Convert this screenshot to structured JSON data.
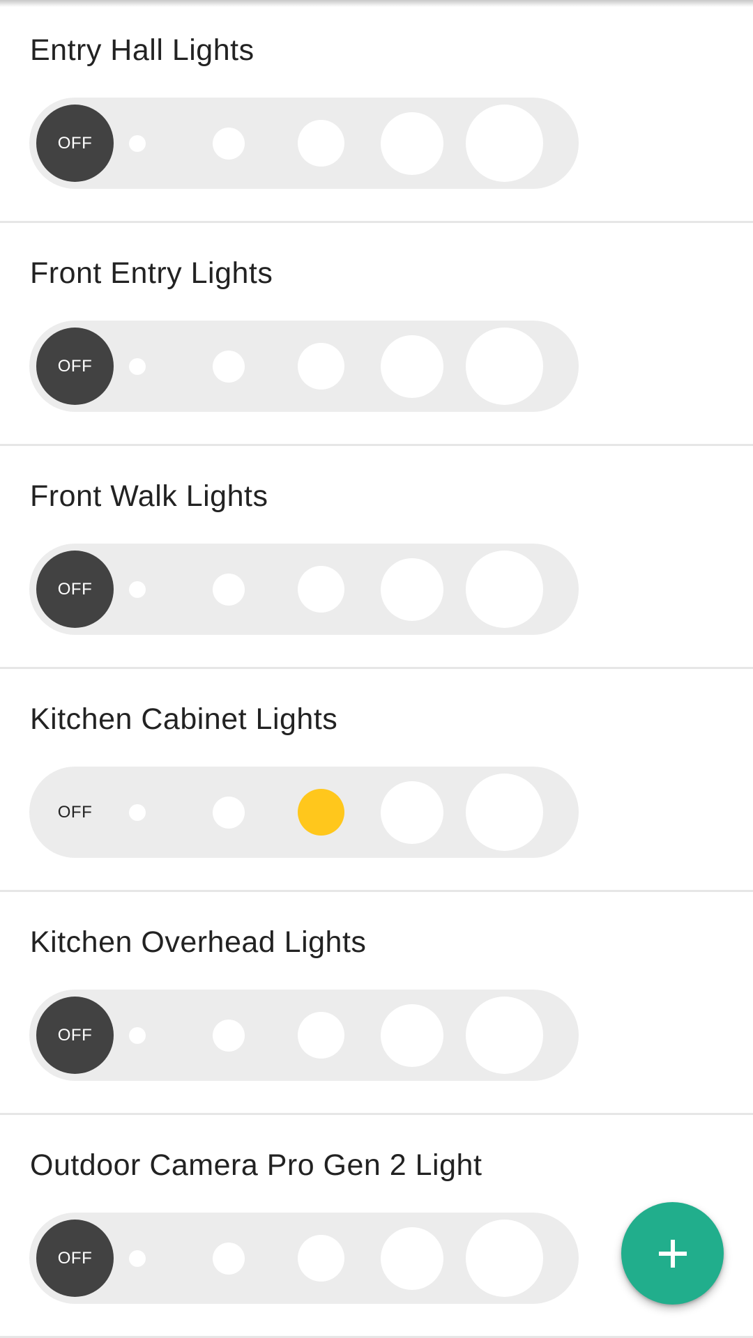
{
  "devices": [
    {
      "name": "Entry Hall Lights",
      "off_label": "OFF",
      "level": 0
    },
    {
      "name": "Front Entry Lights",
      "off_label": "OFF",
      "level": 0
    },
    {
      "name": "Front Walk Lights",
      "off_label": "OFF",
      "level": 0
    },
    {
      "name": "Kitchen Cabinet Lights",
      "off_label": "OFF",
      "level": 3
    },
    {
      "name": "Kitchen Overhead Lights",
      "off_label": "OFF",
      "level": 0
    },
    {
      "name": "Outdoor Camera Pro Gen 2 Light",
      "off_label": "OFF",
      "level": 0
    }
  ],
  "level_steps": 5,
  "colors": {
    "active_level": "#ffc71c",
    "off_selected": "#424242",
    "track": "#ececec",
    "fab": "#21ae8c"
  },
  "fab": {
    "icon": "plus-icon"
  }
}
